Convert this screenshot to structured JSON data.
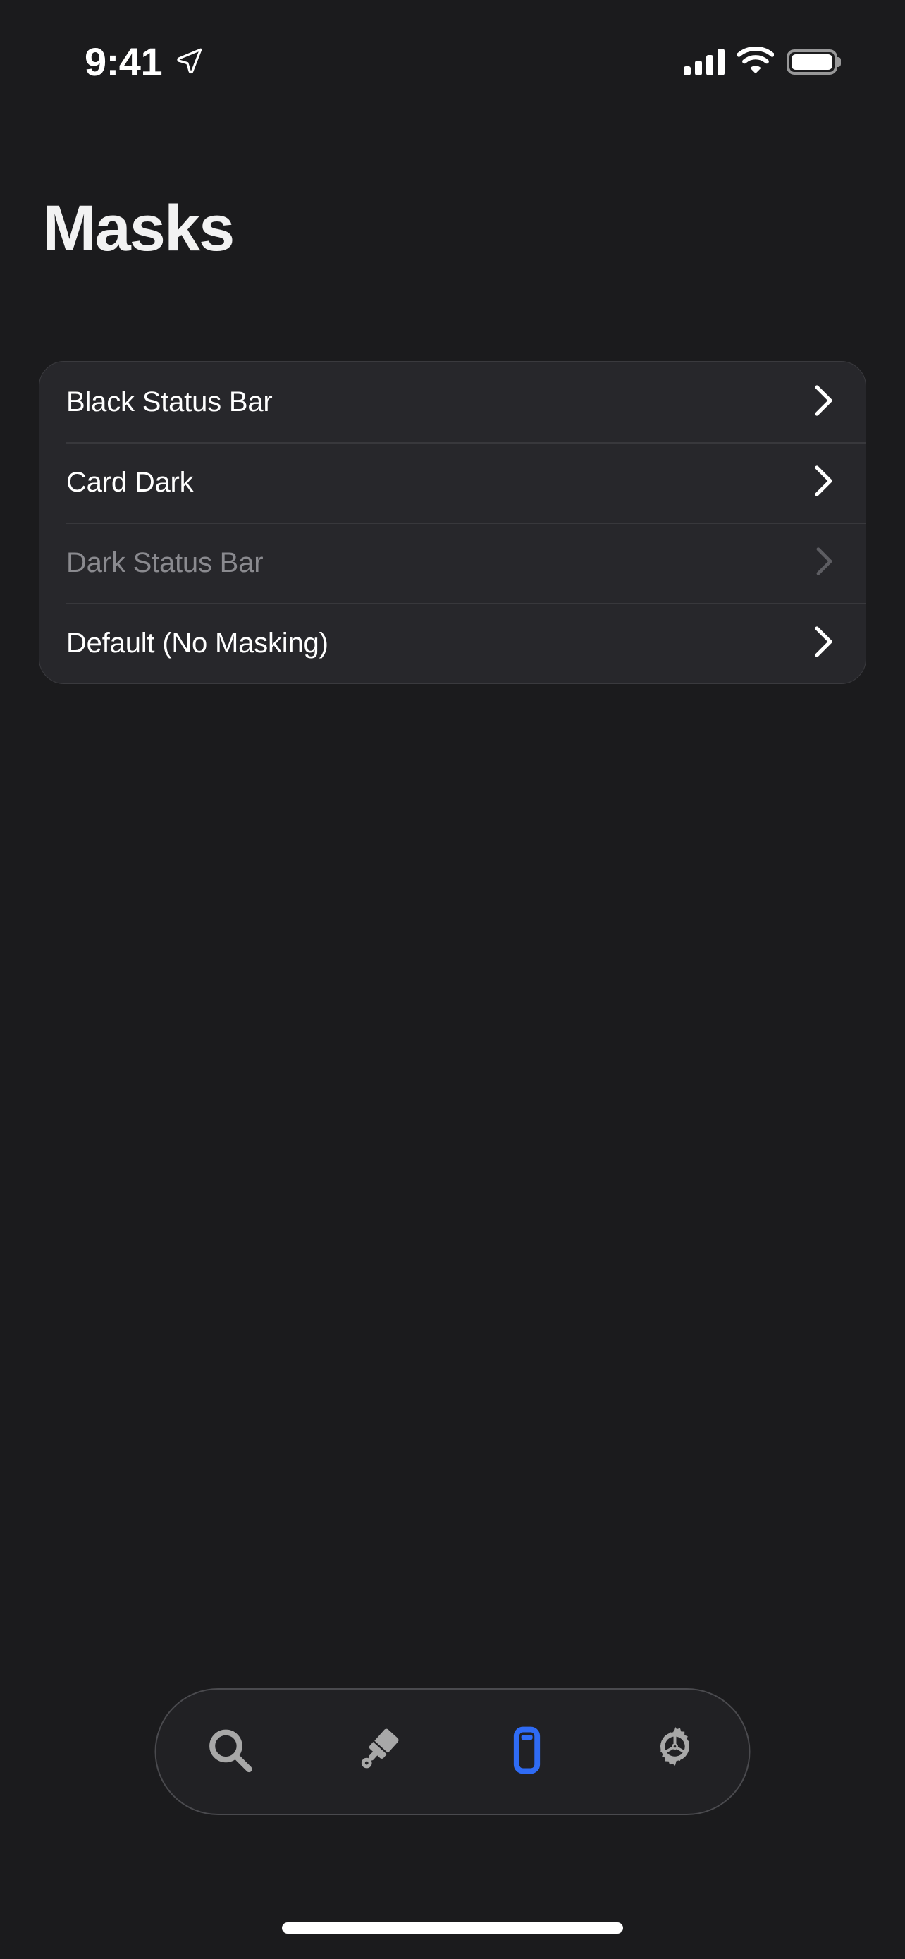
{
  "status_bar": {
    "time": "9:41",
    "location_icon": "location-arrow-icon",
    "cellular_icon": "cellular-signal-icon",
    "cellular_bars_filled": 4,
    "cellular_bars_total": 4,
    "wifi_icon": "wifi-icon",
    "battery_icon": "battery-icon",
    "battery_level": "100"
  },
  "header": {
    "title": "Masks"
  },
  "masks_list": {
    "rows": [
      {
        "label": "Black Status Bar",
        "disabled": false,
        "chevron": "chevron-right-icon"
      },
      {
        "label": "Card Dark",
        "disabled": false,
        "chevron": "chevron-right-icon"
      },
      {
        "label": "Dark Status Bar",
        "disabled": true,
        "chevron": "chevron-right-icon"
      },
      {
        "label": "Default (No Masking)",
        "disabled": false,
        "chevron": "chevron-right-icon"
      }
    ]
  },
  "tab_bar": {
    "active_index": 2,
    "items": [
      {
        "name": "search",
        "icon": "search-icon",
        "active": false
      },
      {
        "name": "brush",
        "icon": "paintbrush-icon",
        "active": false
      },
      {
        "name": "masks",
        "icon": "device-status-bar-icon",
        "active": true
      },
      {
        "name": "settings",
        "icon": "gear-icon",
        "active": false
      }
    ]
  },
  "colors": {
    "background": "#1b1b1d",
    "card": "#27272b",
    "card_border": "#3a3a3e",
    "divider": "#38383c",
    "text_primary": "#ffffff",
    "text_disabled": "#8a8a8f",
    "accent_blue": "#2f6bf5",
    "tab_icon_inactive": "#a8a8a8",
    "home_indicator": "#ffffff"
  }
}
